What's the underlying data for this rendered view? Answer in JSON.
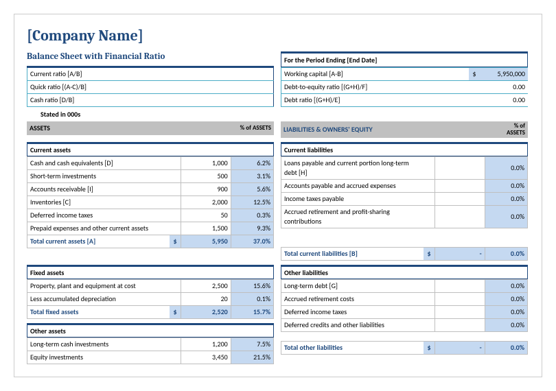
{
  "company_name": "[Company Name]",
  "doc_title": "Balance Sheet with Financial Ratio",
  "period_label": "For the Period Ending [End Date]",
  "stated": "Stated in 000s",
  "ratios_left": {
    "r0": "Current ratio  [A/B]",
    "r1": "Quick ratio  [(A-C)/B]",
    "r2": "Cash ratio  [D/B]"
  },
  "ratios_right": {
    "r0": {
      "label": "Working capital  [A-B]",
      "cur": "$",
      "val": "5,950,000"
    },
    "r1": {
      "label": "Debt-to-equity ratio  [(G+H)/F]",
      "val": "0.00"
    },
    "r2": {
      "label": "Debt ratio  [(G+H)/E]",
      "val": "0.00"
    }
  },
  "headers": {
    "assets": "ASSETS",
    "pct_assets": "% of ASSETS",
    "pct_assets_stack1": "% of",
    "pct_assets_stack2": "ASSETS",
    "liab": "LIABILITIES & OWNERS' EQUITY"
  },
  "assets": {
    "current": {
      "title": "Current assets",
      "rows": {
        "0": {
          "label": "Cash and cash equivalents  [D]",
          "val": "1,000",
          "pct": "6.2%"
        },
        "1": {
          "label": "Short-term investments",
          "val": "500",
          "pct": "3.1%"
        },
        "2": {
          "label": "Accounts receivable  [I]",
          "val": "900",
          "pct": "5.6%"
        },
        "3": {
          "label": "Inventories  [C]",
          "val": "2,000",
          "pct": "12.5%"
        },
        "4": {
          "label": "Deferred income taxes",
          "val": "50",
          "pct": "0.3%"
        },
        "5": {
          "label": "Prepaid expenses and other current assets",
          "val": "1,500",
          "pct": "9.3%"
        }
      },
      "total": {
        "label": "Total current assets  [A]",
        "cur": "$",
        "val": "5,950",
        "pct": "37.0%"
      }
    },
    "fixed": {
      "title": "Fixed assets",
      "rows": {
        "0": {
          "label": "Property, plant and equipment at cost",
          "val": "2,500",
          "pct": "15.6%"
        },
        "1": {
          "label": "Less accumulated depreciation",
          "val": "20",
          "pct": "0.1%"
        }
      },
      "total": {
        "label": "Total fixed assets",
        "cur": "$",
        "val": "2,520",
        "pct": "15.7%"
      }
    },
    "other": {
      "title": "Other assets",
      "rows": {
        "0": {
          "label": "Long-term cash investments",
          "val": "1,200",
          "pct": "7.5%"
        },
        "1": {
          "label": "Equity investments",
          "val": "3,450",
          "pct": "21.5%"
        }
      }
    }
  },
  "liab": {
    "current": {
      "title": "Current liabilities",
      "rows": {
        "0": {
          "label": "Loans payable and current portion long-term debt  [H]",
          "pct": "0.0%"
        },
        "1": {
          "label": "Accounts payable and accrued expenses",
          "pct": "0.0%"
        },
        "2": {
          "label": "Income taxes payable",
          "pct": "0.0%"
        },
        "3": {
          "label": "Accrued retirement and profit-sharing contributions",
          "pct": "0.0%"
        }
      },
      "total": {
        "label": "Total current liabilities  [B]",
        "cur": "$",
        "val": "-",
        "pct": "0.0%"
      }
    },
    "other": {
      "title": "Other liabilities",
      "rows": {
        "0": {
          "label": "Long-term debt  [G]",
          "pct": "0.0%"
        },
        "1": {
          "label": "Accrued retirement costs",
          "pct": "0.0%"
        },
        "2": {
          "label": "Deferred income taxes",
          "pct": "0.0%"
        },
        "3": {
          "label": "Deferred credits and other liabilities",
          "pct": "0.0%"
        }
      },
      "total": {
        "label": "Total other liabilities",
        "cur": "$",
        "val": "-",
        "pct": "0.0%"
      }
    }
  }
}
